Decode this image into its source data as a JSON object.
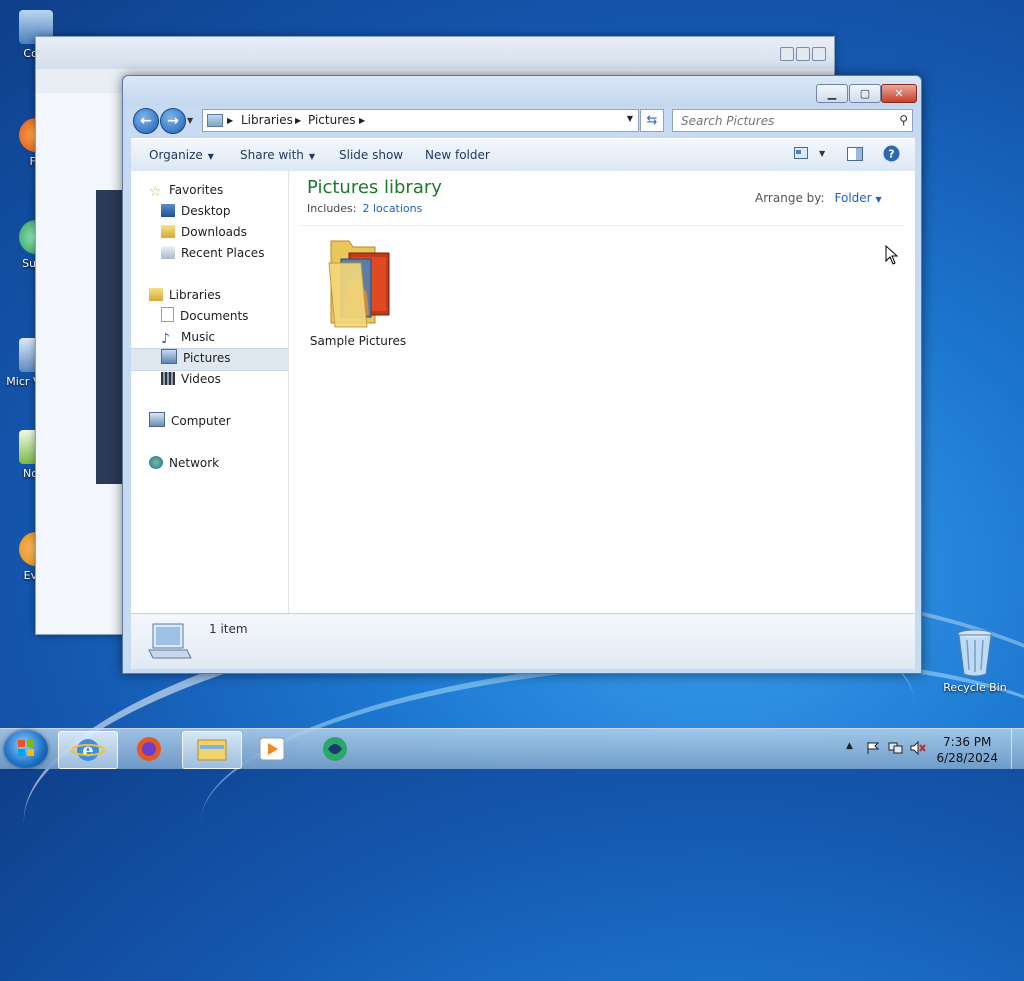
{
  "desktop": {
    "icons": [
      "Com",
      "Fir",
      "Supe",
      "Micr Visual",
      "Note",
      "Ever"
    ],
    "recycle_bin": "Recycle Bin"
  },
  "explorer": {
    "breadcrumb": [
      "Libraries",
      "Pictures"
    ],
    "search_placeholder": "Search Pictures",
    "toolbar": {
      "organize": "Organize",
      "share_with": "Share with",
      "slide_show": "Slide show",
      "new_folder": "New folder"
    },
    "nav": {
      "favorites": "Favorites",
      "desktop": "Desktop",
      "downloads": "Downloads",
      "recent_places": "Recent Places",
      "libraries": "Libraries",
      "documents": "Documents",
      "music": "Music",
      "pictures": "Pictures",
      "videos": "Videos",
      "computer": "Computer",
      "network": "Network"
    },
    "library_title": "Pictures library",
    "includes_label": "Includes:",
    "includes_link": "2 locations",
    "arrange_label": "Arrange by:",
    "arrange_value": "Folder",
    "items": [
      {
        "name": "Sample Pictures"
      }
    ],
    "status": "1 item"
  },
  "taskbar": {
    "time": "7:36 PM",
    "date": "6/28/2024"
  },
  "colors": {
    "library_title": "#1c7a2c",
    "link": "#1d63b8",
    "close_button": "#c7412c"
  }
}
